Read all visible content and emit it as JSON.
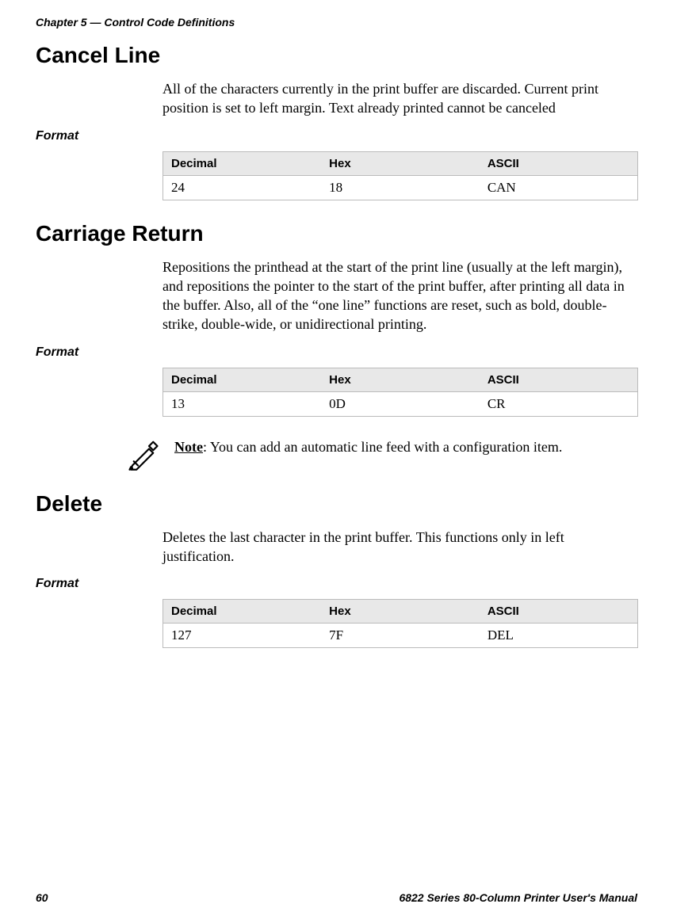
{
  "chapter_header": "Chapter 5 — Control Code Definitions",
  "sections": {
    "cancel_line": {
      "title": "Cancel Line",
      "body": "All of the characters currently in the print buffer are discarded. Current print position is set to left margin. Text already printed cannot be canceled",
      "format_label": "Format",
      "table": {
        "headers": {
          "decimal": "Decimal",
          "hex": "Hex",
          "ascii": "ASCII"
        },
        "row": {
          "decimal": "24",
          "hex": "18",
          "ascii": "CAN"
        }
      }
    },
    "carriage_return": {
      "title": "Carriage Return",
      "body": "Repositions the printhead at the start of the print line (usually at the left margin), and repositions the pointer to the start of the print buffer, after printing all data in the buffer. Also, all of the “one line” functions are reset, such as bold, double-strike, double-wide, or unidirectional printing.",
      "format_label": "Format",
      "table": {
        "headers": {
          "decimal": "Decimal",
          "hex": "Hex",
          "ascii": "ASCII"
        },
        "row": {
          "decimal": "13",
          "hex": "0D",
          "ascii": "CR"
        }
      },
      "note_label": "Note",
      "note_text": ": You can add an automatic line feed with a configuration item."
    },
    "delete": {
      "title": "Delete",
      "body": "Deletes the last character in the print buffer. This functions only in left justification.",
      "format_label": "Format",
      "table": {
        "headers": {
          "decimal": "Decimal",
          "hex": "Hex",
          "ascii": "ASCII"
        },
        "row": {
          "decimal": "127",
          "hex": "7F",
          "ascii": "DEL"
        }
      }
    }
  },
  "footer": {
    "page_number": "60",
    "manual_title": "6822 Series 80-Column Printer User's Manual"
  }
}
